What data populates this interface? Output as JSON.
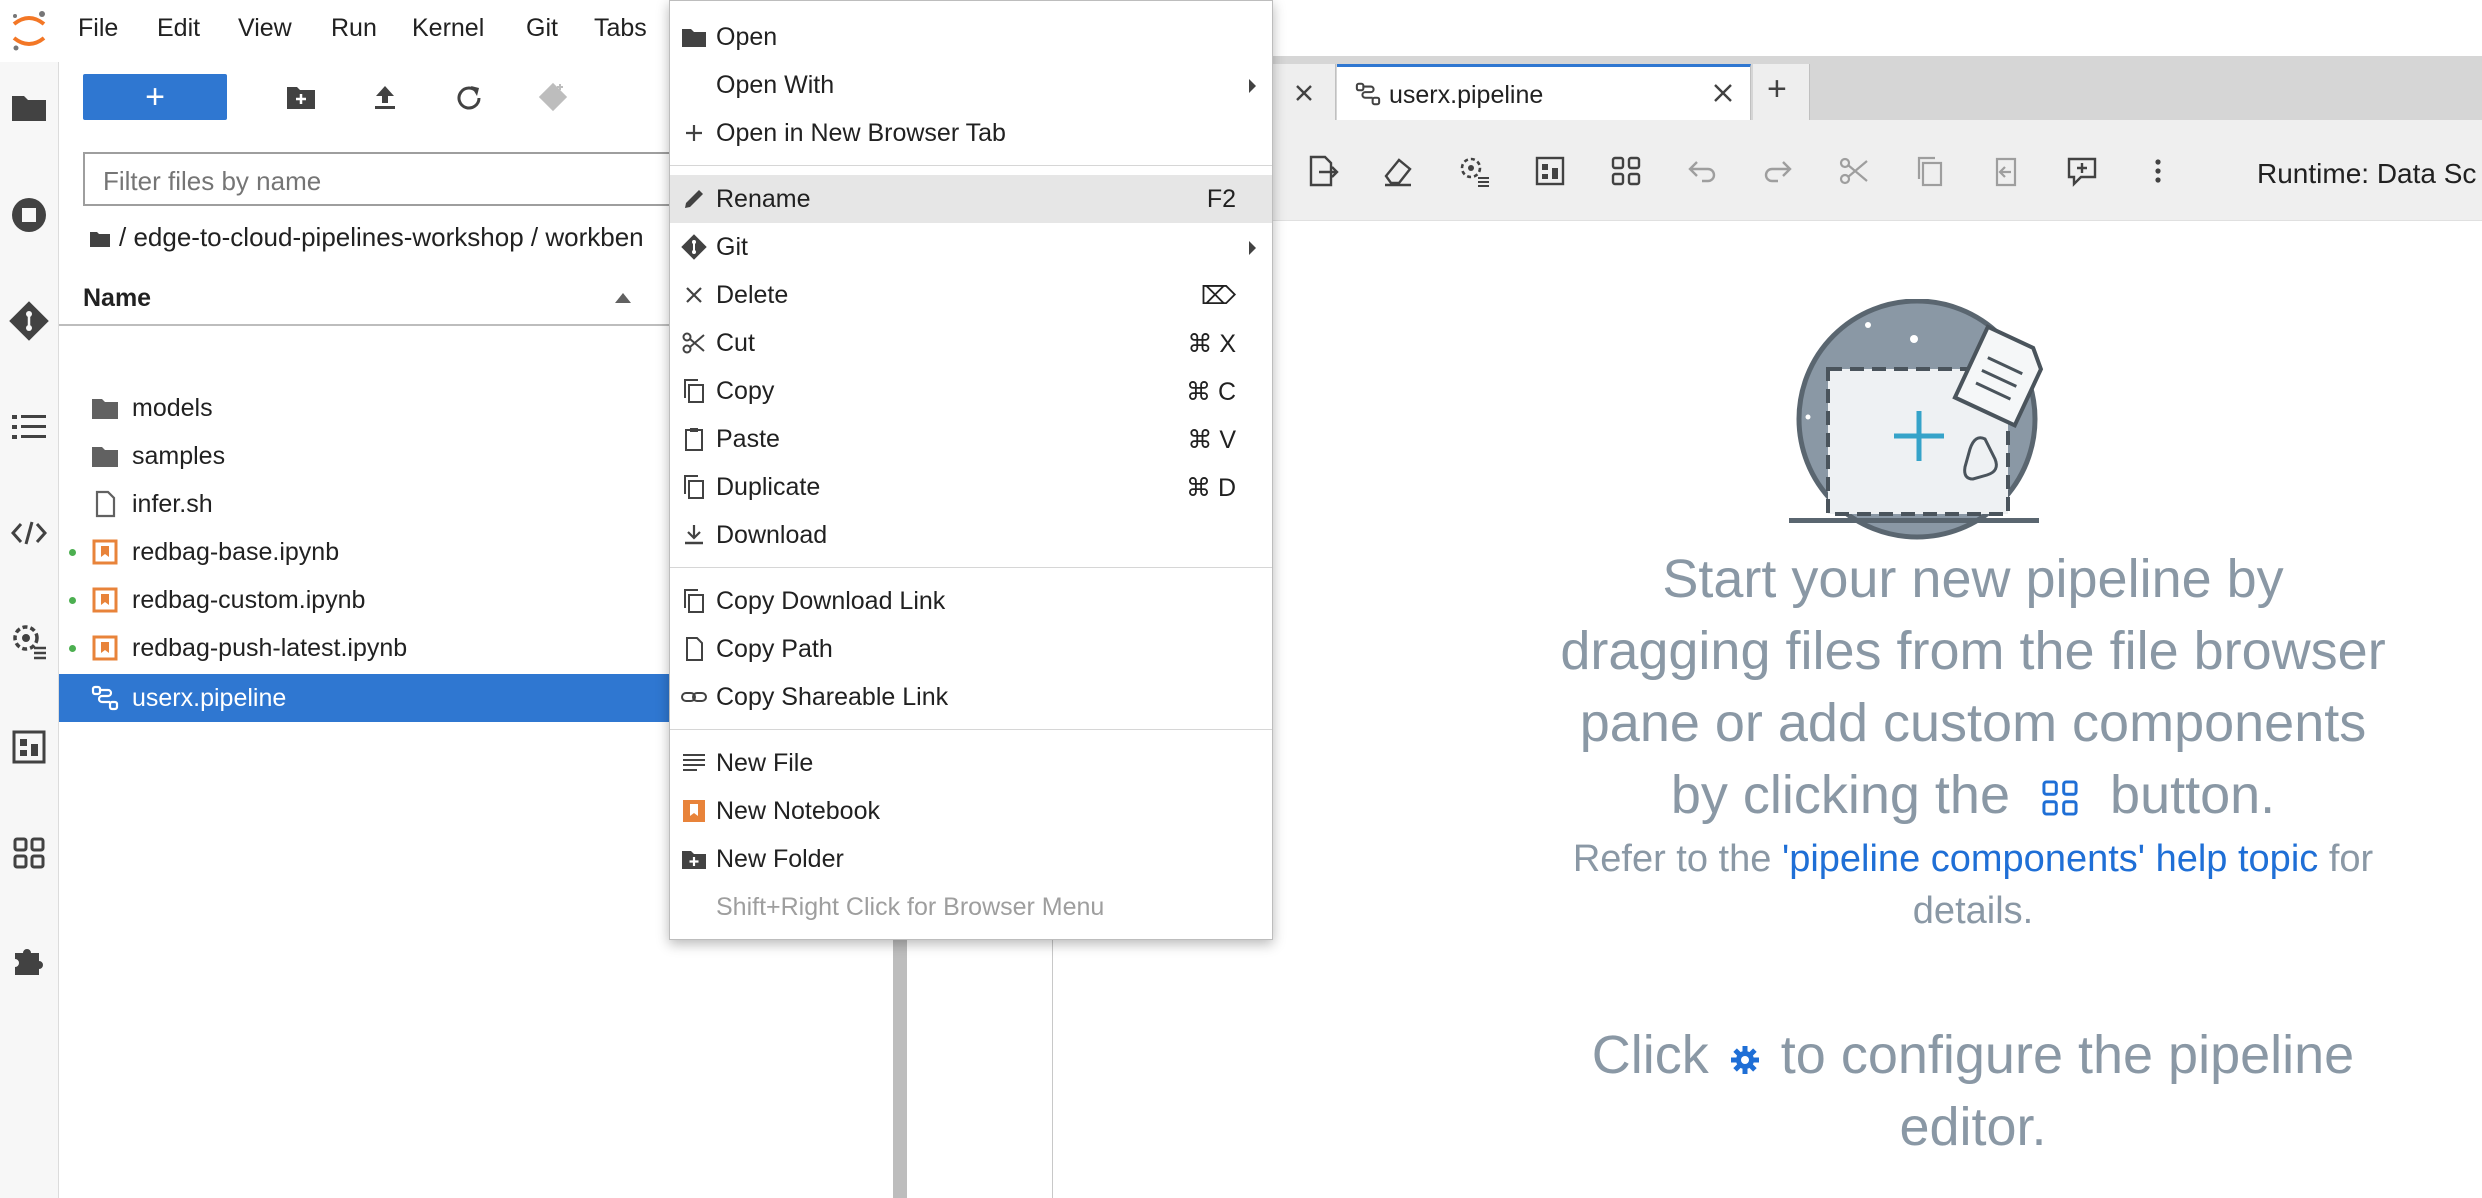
{
  "menubar": {
    "items": [
      "File",
      "Edit",
      "View",
      "Run",
      "Kernel",
      "Git",
      "Tabs"
    ]
  },
  "filebrowser": {
    "new_label": "+",
    "filter_placeholder": "Filter files by name",
    "breadcrumb": "/ edge-to-cloud-pipelines-workshop / workben",
    "column_name": "Name",
    "files": [
      {
        "name": "models",
        "type": "folder"
      },
      {
        "name": "samples",
        "type": "folder"
      },
      {
        "name": "infer.sh",
        "type": "file"
      },
      {
        "name": "redbag-base.ipynb",
        "type": "notebook"
      },
      {
        "name": "redbag-custom.ipynb",
        "type": "notebook"
      },
      {
        "name": "redbag-push-latest.ipynb",
        "type": "notebook"
      },
      {
        "name": "userx.pipeline",
        "type": "pipeline"
      }
    ]
  },
  "tabs": {
    "active_label": "userx.pipeline",
    "add_label": "+"
  },
  "pipeline": {
    "runtime": "Runtime: Data Sc",
    "msg_lines": [
      "Start your new pipeline by",
      "dragging files from the file browser",
      "pane or add custom components"
    ],
    "msg_line4a": "by clicking the",
    "msg_line4b": "button.",
    "help_prefix": "Refer to the ",
    "help_link": "'pipeline components' help topic",
    "help_suffix": " for",
    "help_line2": "details.",
    "config_a": "Click",
    "config_b": "to configure the pipeline",
    "config_line2": "editor."
  },
  "context_menu": {
    "items": [
      {
        "label": "Open",
        "shortcut": "",
        "icon": "folder-icon"
      },
      {
        "label": "Open With",
        "shortcut": "",
        "icon": ""
      },
      {
        "label": "Open in New Browser Tab",
        "shortcut": "",
        "icon": "plus-icon"
      },
      {
        "label": "Rename",
        "shortcut": "F2",
        "icon": "pencil-icon"
      },
      {
        "label": "Git",
        "shortcut": "",
        "icon": "git-icon"
      },
      {
        "label": "Delete",
        "shortcut": "⌦",
        "icon": "close-icon"
      },
      {
        "label": "Cut",
        "shortcut": "⌘ X",
        "icon": "scissors-icon"
      },
      {
        "label": "Copy",
        "shortcut": "⌘ C",
        "icon": "copy-icon"
      },
      {
        "label": "Paste",
        "shortcut": "⌘ V",
        "icon": "paste-icon"
      },
      {
        "label": "Duplicate",
        "shortcut": "⌘ D",
        "icon": "copy-icon"
      },
      {
        "label": "Download",
        "shortcut": "",
        "icon": "download-icon"
      },
      {
        "label": "Copy Download Link",
        "shortcut": "",
        "icon": "copy-icon"
      },
      {
        "label": "Copy Path",
        "shortcut": "",
        "icon": "file-icon"
      },
      {
        "label": "Copy Shareable Link",
        "shortcut": "",
        "icon": "link-icon"
      },
      {
        "label": "New File",
        "shortcut": "",
        "icon": "text-file-icon"
      },
      {
        "label": "New Notebook",
        "shortcut": "",
        "icon": "notebook-icon"
      },
      {
        "label": "New Folder",
        "shortcut": "",
        "icon": "new-folder-icon"
      },
      {
        "label": "Shift+Right Click for Browser Menu",
        "shortcut": "",
        "icon": ""
      }
    ]
  },
  "colors": {
    "accent": "#2f77d1",
    "notebook": "#e8833a",
    "message": "#8a98a5",
    "link": "#1f6fd6"
  }
}
